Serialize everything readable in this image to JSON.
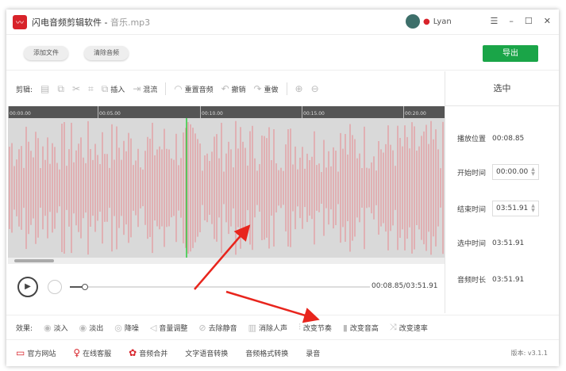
{
  "title": {
    "app": "闪电音频剪辑软件 - ",
    "file": "音乐.mp3"
  },
  "user": {
    "name": "Lyan"
  },
  "window_controls": [
    "☰",
    "–",
    "☐",
    "✕"
  ],
  "toolbar": {
    "add_file": "添加文件",
    "clear_audio": "清除音频",
    "export": "导出"
  },
  "edit": {
    "label": "剪辑:",
    "insert": "插入",
    "mix": "混流",
    "reset": "重置音频",
    "undo": "撤销",
    "redo": "重做"
  },
  "ruler": [
    "00:00.00",
    "00:05.00",
    "00:10.00",
    "00:15.00",
    "00:20.00"
  ],
  "panel": {
    "header": "选中",
    "play_pos_label": "播放位置",
    "play_pos": "00:08.85",
    "start_label": "开始时间",
    "start": "00:00.00",
    "end_label": "结束时间",
    "end": "03:51.91",
    "sel_label": "选中时间",
    "sel": "03:51.91",
    "dur_label": "音频时长",
    "dur": "03:51.91"
  },
  "player": {
    "time": "00:08.85/03:51.91",
    "progress_fraction": 0.038
  },
  "effects": {
    "label": "效果:",
    "items": [
      "淡入",
      "淡出",
      "降噪",
      "音量调整",
      "去除静音",
      "消除人声",
      "改变节奏",
      "改变音高",
      "改变速率"
    ]
  },
  "bottom": {
    "items": [
      "官方网站",
      "在线客服",
      "音频合并",
      "文字语音转换",
      "音频格式转换",
      "录音"
    ],
    "version": "版本: v3.1.1"
  },
  "colors": {
    "accent": "#1aa548",
    "brand": "#d8232a",
    "wave": "#e8878d",
    "playhead": "#2ecc40"
  }
}
